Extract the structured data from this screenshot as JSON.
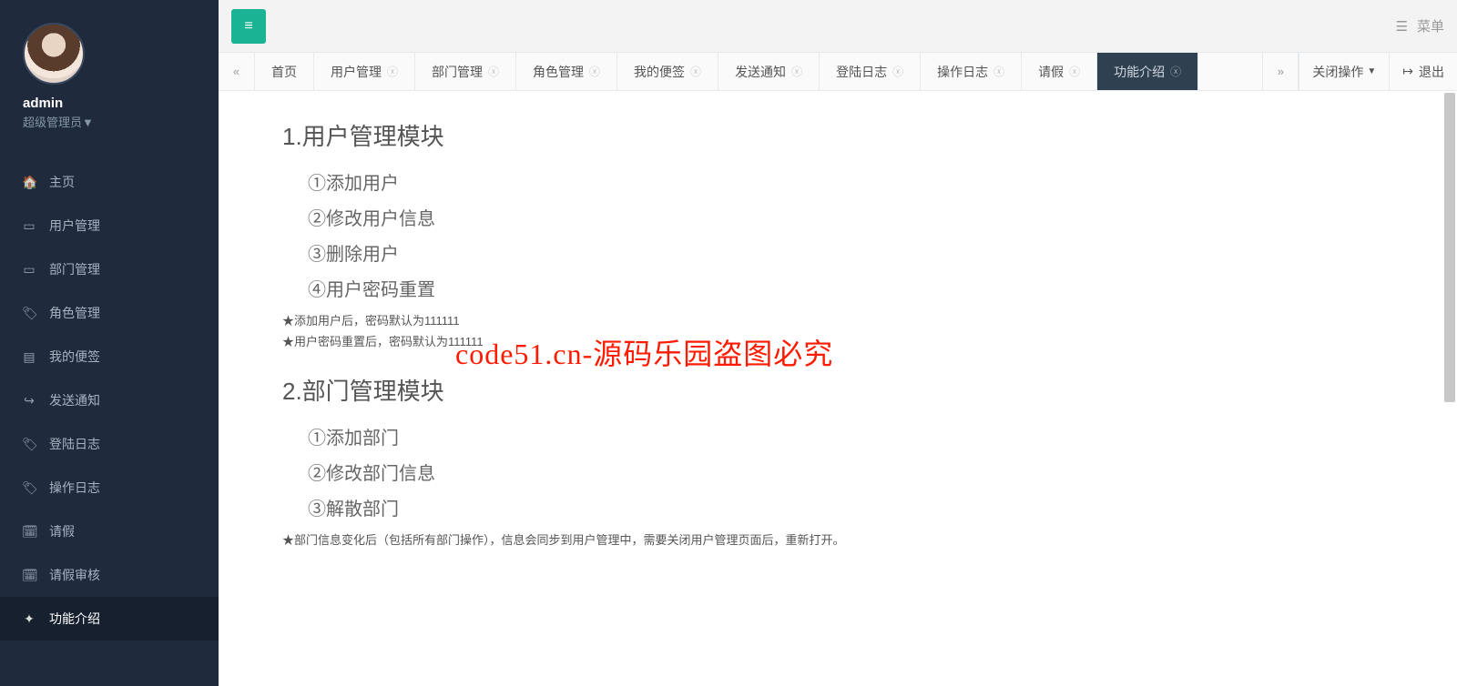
{
  "user": {
    "name": "admin",
    "role": "超级管理员▼"
  },
  "sidebar": {
    "items": [
      {
        "icon": "🏠",
        "label": "主页"
      },
      {
        "icon": "▭",
        "label": "用户管理"
      },
      {
        "icon": "▭",
        "label": "部门管理"
      },
      {
        "icon": "🏷",
        "label": "角色管理"
      },
      {
        "icon": "▤",
        "label": "我的便签"
      },
      {
        "icon": "↪",
        "label": "发送通知"
      },
      {
        "icon": "🏷",
        "label": "登陆日志"
      },
      {
        "icon": "🏷",
        "label": "操作日志"
      },
      {
        "icon": "🗓",
        "label": "请假"
      },
      {
        "icon": "🗓",
        "label": "请假审核"
      },
      {
        "icon": "✦",
        "label": "功能介绍"
      }
    ]
  },
  "topbar": {
    "menu_label": "菜单"
  },
  "tabs": {
    "scroll_left": "«",
    "scroll_right": "»",
    "close_ops": "关闭操作",
    "exit": "退出",
    "items": [
      {
        "label": "首页",
        "closable": false
      },
      {
        "label": "用户管理",
        "closable": true
      },
      {
        "label": "部门管理",
        "closable": true
      },
      {
        "label": "角色管理",
        "closable": true
      },
      {
        "label": "我的便签",
        "closable": true
      },
      {
        "label": "发送通知",
        "closable": true
      },
      {
        "label": "登陆日志",
        "closable": true
      },
      {
        "label": "操作日志",
        "closable": true
      },
      {
        "label": "请假",
        "closable": true
      },
      {
        "label": "功能介绍",
        "closable": true,
        "active": true
      }
    ]
  },
  "content": {
    "s1_title": "1.用户管理模块",
    "s1_items": [
      "①添加用户",
      "②修改用户信息",
      "③删除用户",
      "④用户密码重置"
    ],
    "s1_notes": [
      "★添加用户后，密码默认为111111",
      "★用户密码重置后，密码默认为111111"
    ],
    "s2_title": "2.部门管理模块",
    "s2_items": [
      "①添加部门",
      "②修改部门信息",
      "③解散部门"
    ],
    "s2_notes": [
      "★部门信息变化后（包括所有部门操作），信息会同步到用户管理中，需要关闭用户管理页面后，重新打开。"
    ]
  },
  "watermark": "code51.cn-源码乐园盗图必究"
}
